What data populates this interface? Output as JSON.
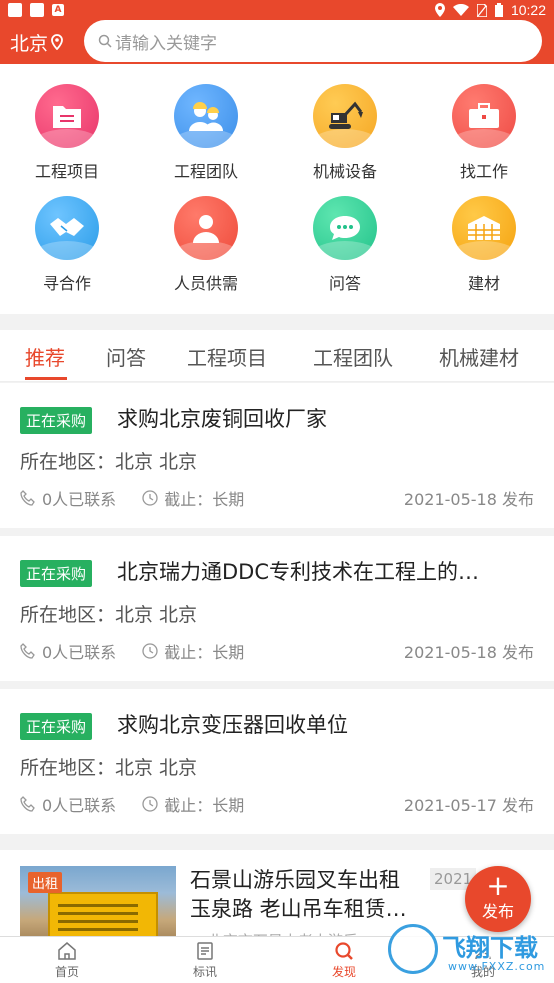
{
  "status_bar": {
    "time": "10:22",
    "app_badge": "A"
  },
  "header": {
    "city": "北京",
    "search_placeholder": "请输入关键字"
  },
  "categories": [
    {
      "label": "工程项目",
      "icon": "folder-icon",
      "color": "#e8356a"
    },
    {
      "label": "工程团队",
      "icon": "team-icon",
      "color": "#3b8ee8"
    },
    {
      "label": "机械设备",
      "icon": "excavator-icon",
      "color": "#f5a623"
    },
    {
      "label": "找工作",
      "icon": "briefcase-icon",
      "color": "#ee4a44"
    },
    {
      "label": "寻合作",
      "icon": "handshake-icon",
      "color": "#2a9ce8"
    },
    {
      "label": "人员供需",
      "icon": "person-icon",
      "color": "#ee4a3a"
    },
    {
      "label": "问答",
      "icon": "chat-icon",
      "color": "#22c28a"
    },
    {
      "label": "建材",
      "icon": "materials-icon",
      "color": "#f5a20f"
    }
  ],
  "tabs": [
    "推荐",
    "问答",
    "工程项目",
    "工程团队",
    "机械建材"
  ],
  "active_tab": "推荐",
  "listings": [
    {
      "badge": "正在采购",
      "title": "求购北京废铜回收厂家",
      "region": "所在地区：北京 北京",
      "contacts": "0人已联系",
      "deadline": "截止：长期",
      "date": "2021-05-18  发布"
    },
    {
      "badge": "正在采购",
      "title": "北京瑞力通DDC专利技术在工程上的…",
      "region": "所在地区：北京 北京",
      "contacts": "0人已联系",
      "deadline": "截止：长期",
      "date": "2021-05-18  发布"
    },
    {
      "badge": "正在采购",
      "title": "求购北京变压器回收单位",
      "region": "所在地区：北京 北京",
      "contacts": "0人已联系",
      "deadline": "截止：长期",
      "date": "2021-05-17  发布"
    }
  ],
  "rental": {
    "badge": "出租",
    "title_line1": "石景山游乐园叉车出租",
    "title_line2": "玉泉路 老山吊车租赁…",
    "date": "2021",
    "address": "北京市石景山老山游乐"
  },
  "fab": {
    "label": "发布"
  },
  "bottom_nav": [
    {
      "label": "首页",
      "icon": "home-icon"
    },
    {
      "label": "标讯",
      "icon": "document-icon"
    },
    {
      "label": "发现",
      "icon": "search-icon"
    },
    {
      "label": "我的",
      "icon": "user-icon"
    }
  ],
  "active_nav": "发现",
  "watermark": {
    "text": "飞翔下载",
    "sub": "www.FXXZ.com"
  }
}
